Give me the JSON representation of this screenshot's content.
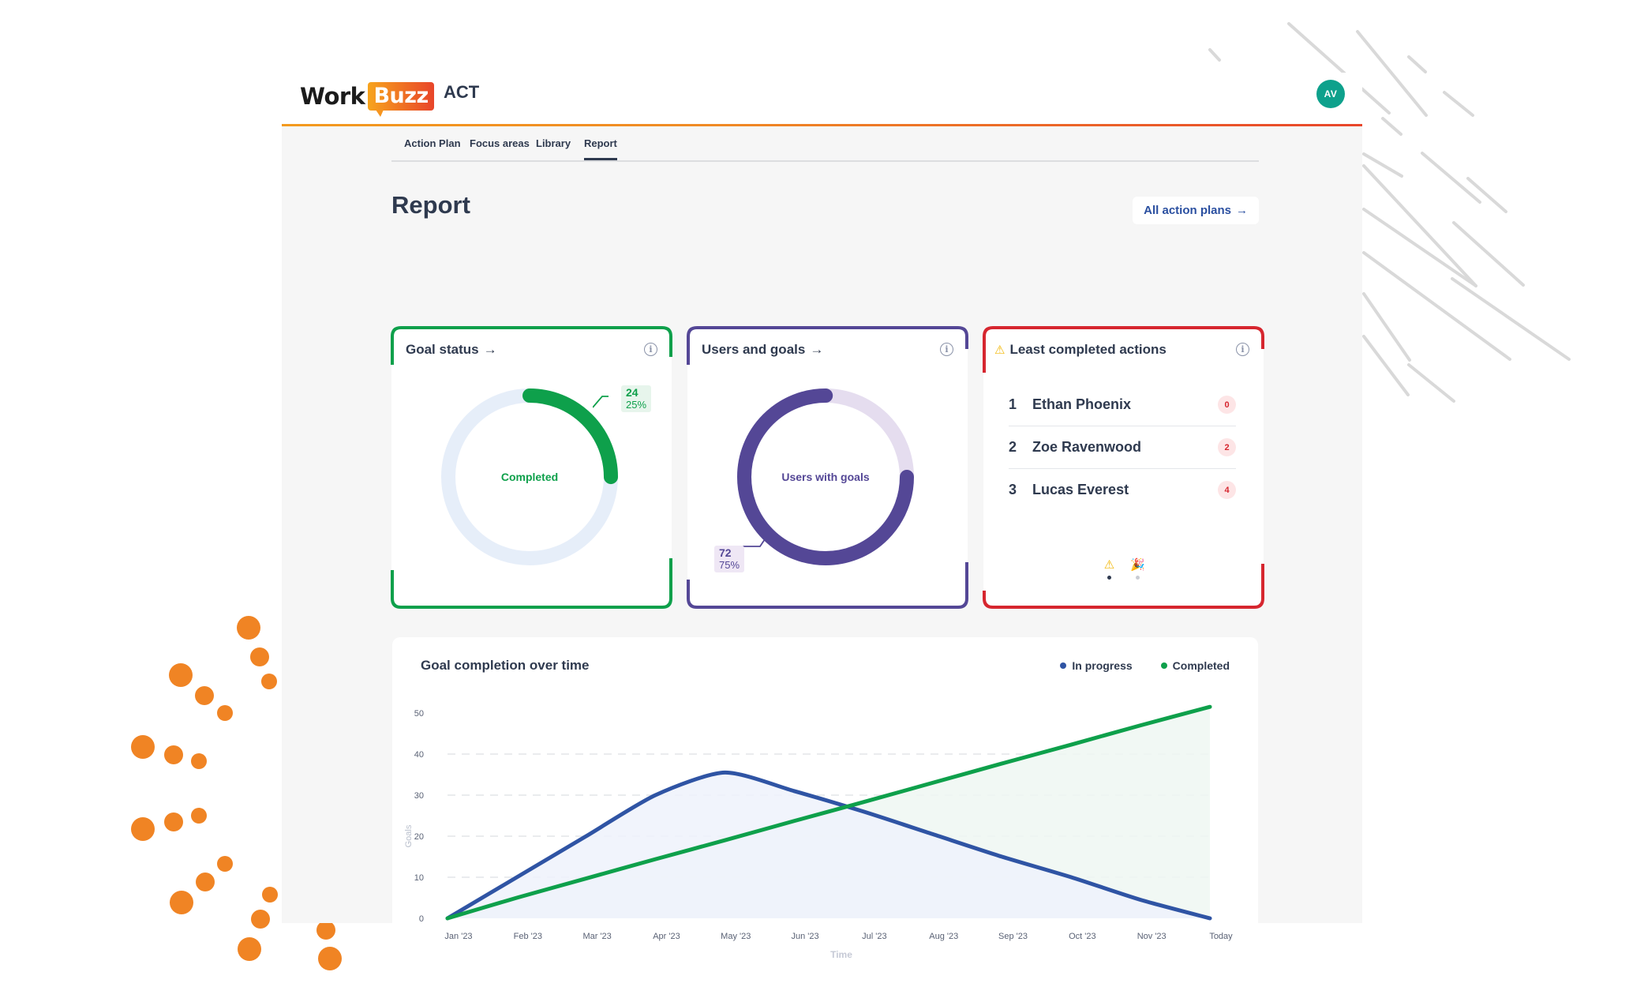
{
  "header": {
    "logo_work": "Work",
    "logo_buzz": "Buzz",
    "app_name": "ACT",
    "avatar_initials": "AV"
  },
  "nav": {
    "tabs": [
      {
        "label": "Action Plan",
        "active": false
      },
      {
        "label": "Focus areas",
        "active": false
      },
      {
        "label": "Library",
        "active": false
      },
      {
        "label": "Report",
        "active": true
      }
    ]
  },
  "page": {
    "title": "Report",
    "all_plans_label": "All action plans",
    "arrow": "→"
  },
  "goal_status": {
    "title": "Goal status",
    "arrow": "→",
    "info": "i",
    "center_label": "Completed",
    "value": "24",
    "percent_label": "25%",
    "fraction": 0.25,
    "color": "#0ea04b",
    "track_color": "#e6eef9"
  },
  "users_goals": {
    "title": "Users and goals",
    "arrow": "→",
    "info": "i",
    "center_label": "Users with goals",
    "value": "72",
    "percent_label": "75%",
    "fraction": 0.75,
    "color": "#544796",
    "track_color": "#e5ddef"
  },
  "least_completed": {
    "title": "Least completed actions",
    "warning_icon": "⚠",
    "info": "i",
    "color": "#d6262f",
    "rows": [
      {
        "rank": "1",
        "name": "Ethan Phoenix",
        "count": "0"
      },
      {
        "rank": "2",
        "name": "Zoe Ravenwood",
        "count": "2"
      },
      {
        "rank": "3",
        "name": "Lucas Everest",
        "count": "4"
      }
    ],
    "pager": [
      {
        "icon": "⚠",
        "active": true
      },
      {
        "icon": "🎉",
        "active": false
      }
    ]
  },
  "colors": {
    "in_progress": "#2f54a4",
    "completed": "#0ea04b",
    "accent_orange": "#f08424",
    "avatar": "#0ea18c"
  },
  "chart_data": {
    "type": "area",
    "title": "Goal completion over time",
    "xlabel": "Time",
    "ylabel": "Goals",
    "categories": [
      "Jan '23",
      "Feb '23",
      "Mar '23",
      "Apr '23",
      "May '23",
      "Jun '23",
      "Jul '23",
      "Aug '23",
      "Sep '23",
      "Oct '23",
      "Nov '23",
      "Today"
    ],
    "ylim": [
      0,
      50
    ],
    "yticks": [
      0,
      10,
      20,
      30,
      40,
      50
    ],
    "grid": true,
    "legend": "top-right",
    "series": [
      {
        "name": "In progress",
        "color": "#2f54a4",
        "fill": "#eef2fb",
        "values": [
          0,
          10,
          20,
          30,
          35.5,
          31,
          26,
          20.5,
          15,
          10,
          4.5,
          0
        ]
      },
      {
        "name": "Completed",
        "color": "#0ea04b",
        "fill": "#eef7f2",
        "values": [
          0,
          5,
          9.7,
          14.4,
          19,
          23.7,
          28.3,
          33,
          37.7,
          42.3,
          47,
          51.5
        ]
      }
    ]
  }
}
